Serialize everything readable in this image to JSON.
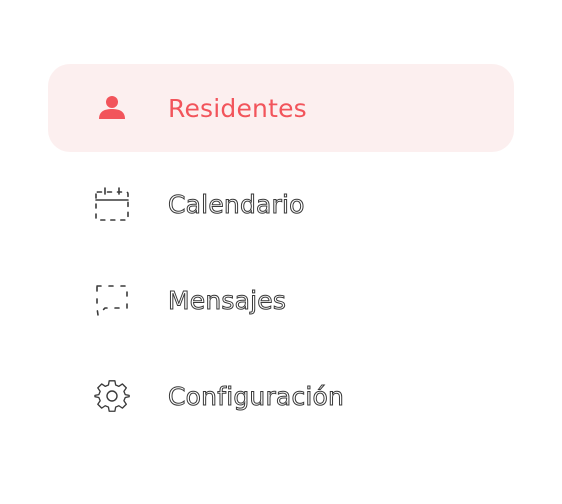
{
  "nav": {
    "items": [
      {
        "label": "Residentes",
        "icon": "person-icon",
        "active": true
      },
      {
        "label": "Calendario",
        "icon": "calendar-icon",
        "active": false
      },
      {
        "label": "Mensajes",
        "icon": "message-icon",
        "active": false
      },
      {
        "label": "Configuración",
        "icon": "gear-icon",
        "active": false
      }
    ]
  },
  "colors": {
    "accent": "#f2545b",
    "active_bg": "#fcefef",
    "outline_text": "#3a3a3a",
    "background": "#ffffff"
  }
}
